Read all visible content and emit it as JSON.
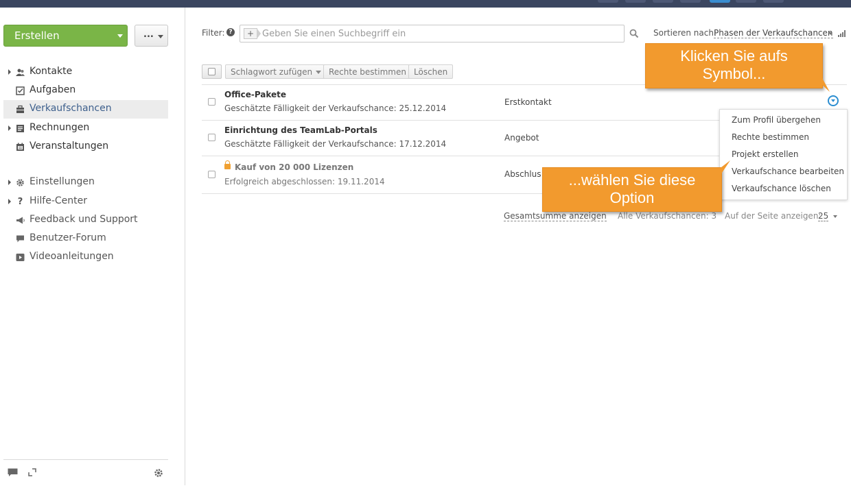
{
  "sidebar": {
    "create_label": "Erstellen",
    "more_label": "...",
    "nav": [
      {
        "label": "Kontakte",
        "icon": "contacts-icon",
        "expandable": true
      },
      {
        "label": "Aufgaben",
        "icon": "tasks-icon",
        "expandable": false
      },
      {
        "label": "Verkaufschancen",
        "icon": "opportunities-icon",
        "expandable": false,
        "active": true
      },
      {
        "label": "Rechnungen",
        "icon": "invoices-icon",
        "expandable": true
      },
      {
        "label": "Veranstaltungen",
        "icon": "events-icon",
        "expandable": false
      }
    ],
    "nav2": [
      {
        "label": "Einstellungen",
        "icon": "gear-icon",
        "expandable": true
      },
      {
        "label": "Hilfe-Center",
        "icon": "help-icon",
        "expandable": true
      },
      {
        "label": "Feedback und Support",
        "icon": "megaphone-icon",
        "expandable": false
      },
      {
        "label": "Benutzer-Forum",
        "icon": "forum-icon",
        "expandable": false
      },
      {
        "label": "Videoanleitungen",
        "icon": "video-icon",
        "expandable": false
      }
    ]
  },
  "filter": {
    "label": "Filter:",
    "plus": "+",
    "placeholder": "Geben Sie einen Suchbegriff ein",
    "value": "",
    "sort_label": "Sortieren nach:",
    "sort_value": "Phasen der Verkaufschancen"
  },
  "toolbar": {
    "tag_label": "Schlagwort zufügen",
    "rights_label": "Rechte bestimmen",
    "delete_label": "Löschen"
  },
  "rows": [
    {
      "title": "Office-Pakete",
      "subtitle": "Geschätzte Fälligkeit der Verkaufschance: 25.12.2014",
      "stage": "Erstkontakt",
      "locked": false
    },
    {
      "title": "Einrichtung des TeamLab-Portals",
      "subtitle": "Geschätzte Fälligkeit der Verkaufschance: 17.12.2014",
      "stage": "Angebot",
      "locked": false
    },
    {
      "title": "Kauf von 20 000 Lizenzen",
      "subtitle": "Erfolgreich abgeschlossen: 19.11.2014",
      "stage": "Abschlus",
      "locked": true
    }
  ],
  "footer": {
    "total_link": "Gesamtsumme anzeigen",
    "all_count": "Alle Verkaufschancen: 3",
    "per_page_label": "Auf der Seite anzeigen:",
    "per_page_value": "25"
  },
  "action_menu": {
    "items": [
      "Zum Profil übergehen",
      "Rechte bestimmen",
      "Projekt erstellen",
      "Verkaufschance bearbeiten",
      "Verkaufschance löschen"
    ]
  },
  "callouts": {
    "top": [
      "Klicken Sie aufs",
      "Symbol..."
    ],
    "bottom": [
      "...wählen Sie diese",
      "Option"
    ]
  },
  "colors": {
    "accent_green": "#7ab547",
    "callout_orange": "#f29a2e",
    "action_blue": "#2c8ed1",
    "topbar": "#3b4660"
  }
}
